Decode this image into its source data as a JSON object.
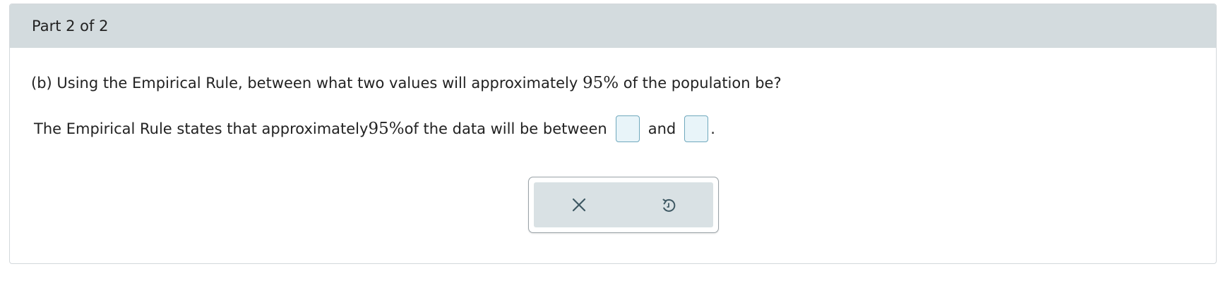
{
  "header": {
    "title": "Part 2 of 2"
  },
  "question": {
    "prefix": "(b) Using the Empirical Rule, between what two values will approximately ",
    "math": "95%",
    "suffix": " of the population be?"
  },
  "answer": {
    "prefix": "The Empirical Rule states that approximately ",
    "math": "95%",
    "middle": " of the data will be between",
    "connector": "and",
    "period": ".",
    "blank1_value": "",
    "blank2_value": ""
  },
  "toolbar": {
    "clear_icon": "close-icon",
    "undo_icon": "undo-icon"
  },
  "colors": {
    "header_bg": "#d3dbde",
    "blank_border": "#6fa8bd",
    "blank_bg": "#e8f4f9",
    "toolbar_bg": "#d9e1e4",
    "icon": "#3e5863"
  }
}
